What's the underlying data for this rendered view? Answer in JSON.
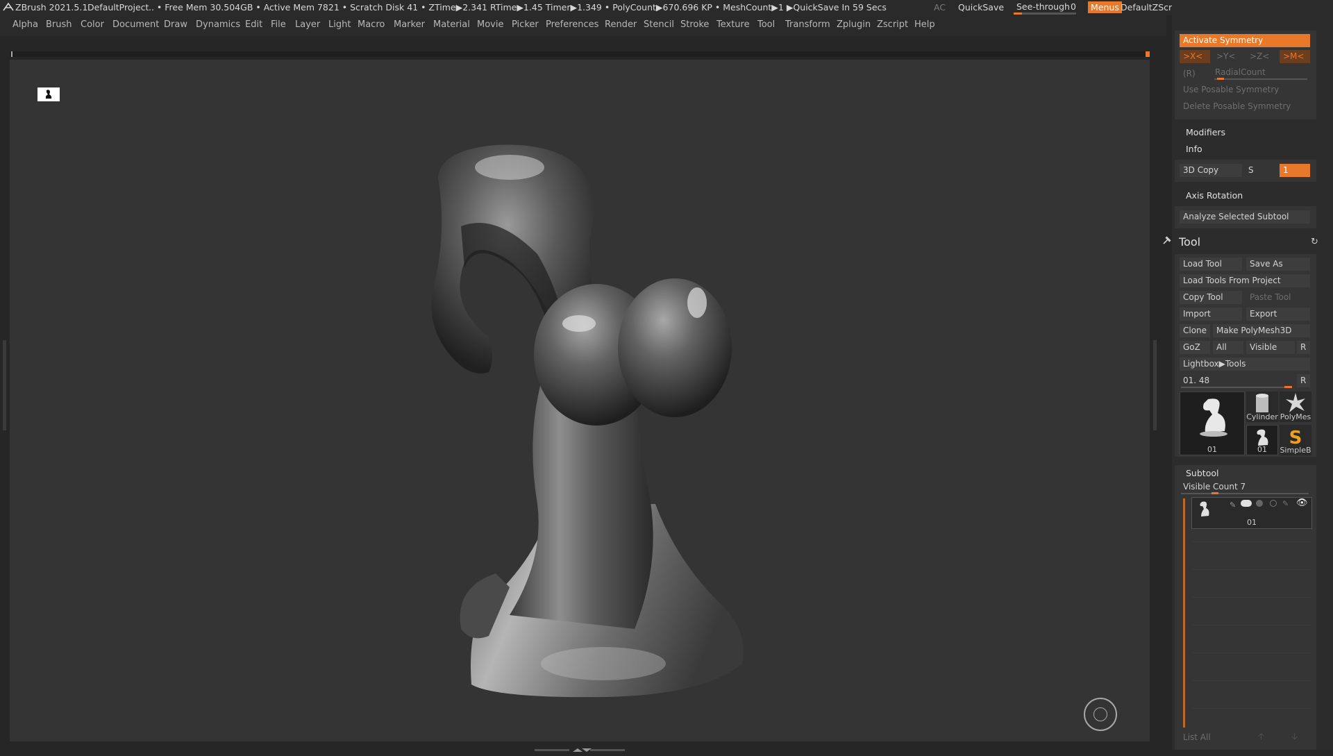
{
  "titlebar": {
    "app": "ZBrush 2021.5.1",
    "project": "DefaultProject",
    "stats": ".. • Free Mem 30.504GB • Active Mem 7821 • Scratch Disk 41 •  ZTime▶2.341 RTime▶1.45 Timer▶1.349 • PolyCount▶670.696 KP  • MeshCount▶1  ▶QuickSave In 59 Secs",
    "ac": "AC",
    "quicksave": "QuickSave",
    "seethrough": "See-through",
    "seethrough_value": "0",
    "seethrough_level": 0.0,
    "menus": "Menus",
    "script": "DefaultZScript"
  },
  "menu": [
    "Alpha",
    "Brush",
    "Color",
    "Document",
    "Draw",
    "Dynamics",
    "Edit",
    "File",
    "Layer",
    "Light",
    "Macro",
    "Marker",
    "Material",
    "Movie",
    "Picker",
    "Preferences",
    "Render",
    "Stencil",
    "Stroke",
    "Texture",
    "Tool",
    "Transform",
    "Zplugin",
    "Zscript",
    "Help"
  ],
  "symmetry": {
    "activate": "Activate Symmetry",
    "x": ">X<",
    "y": ">Y<",
    "z": ">Z<",
    "m": ">M<",
    "r": "(R)",
    "radial": "RadialCount",
    "use_posable": "Use Posable Symmetry",
    "delete_posable": "Delete Posable Symmetry"
  },
  "modifiers": "Modifiers",
  "info": "Info",
  "copy3d": {
    "label": "3D Copy",
    "s": "S",
    "field": "1"
  },
  "axis_rotation": "Axis Rotation",
  "analyze": "Analyze Selected Subtool",
  "tool": {
    "title": "Tool",
    "load_tool": "Load Tool",
    "save_as": "Save As",
    "load_from_project": "Load Tools From Project",
    "copy_tool": "Copy Tool",
    "paste_tool": "Paste Tool",
    "import": "Import",
    "export": "Export",
    "clone": "Clone",
    "make_polymesh": "Make PolyMesh3D",
    "goz": "GoZ",
    "all": "All",
    "visible": "Visible",
    "r": "R",
    "lightbox": "Lightbox▶Tools",
    "current": "01. 48",
    "r2": "R",
    "thumbs": [
      {
        "name": "01",
        "icon": "current-tool-thumbnail"
      },
      {
        "name": "Cylinder",
        "icon": "cylinder-icon"
      },
      {
        "name": "PolyMes",
        "icon": "polymesh-star-icon"
      },
      {
        "name": "01",
        "icon": "small-tool-thumbnail"
      },
      {
        "name": "SimpleB",
        "icon": "simplebrush-icon"
      }
    ]
  },
  "subtool": {
    "title": "Subtool",
    "visible_count": "Visible Count 7",
    "item_name": "01",
    "list_all": "List All"
  },
  "colors": {
    "accent": "#e8782a",
    "panel": "#2c2c2c",
    "viewport": "#343434"
  }
}
